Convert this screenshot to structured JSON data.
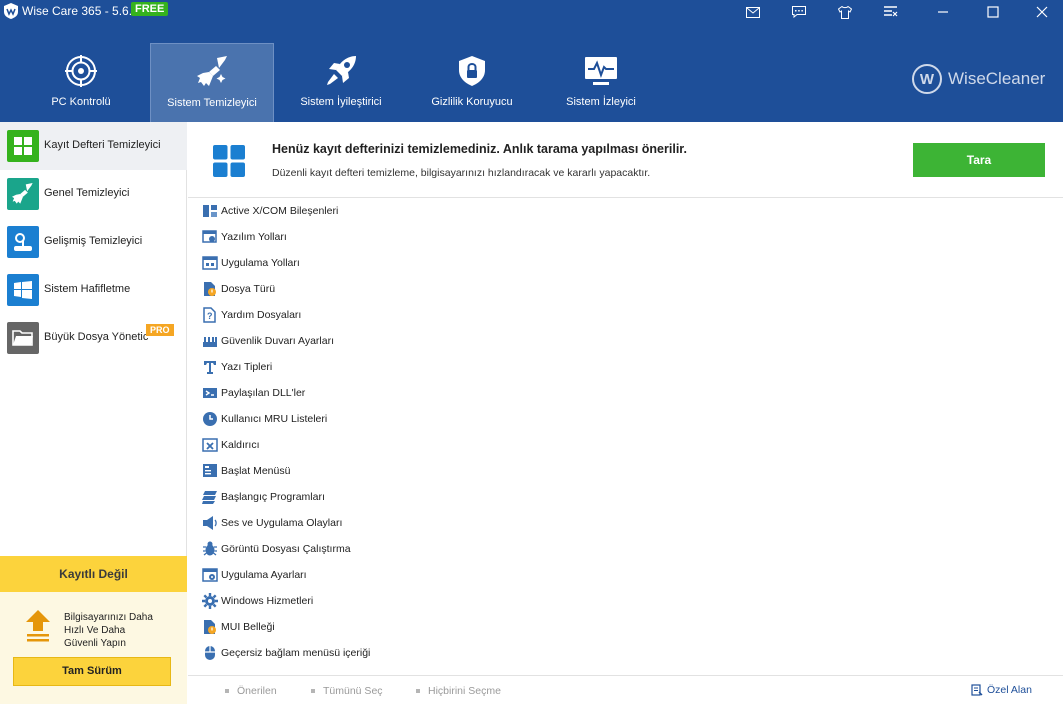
{
  "titlebar": {
    "title": "Wise Care 365 - 5.6.7",
    "badge": "FREE",
    "controls": [
      "mail-icon",
      "feedback-icon",
      "skin-icon",
      "menu-icon",
      "minimize-icon",
      "maximize-icon",
      "close-icon"
    ]
  },
  "nav": {
    "items": [
      {
        "label": "PC Kontrolü",
        "icon": "crosshair-icon"
      },
      {
        "label": "Sistem Temizleyici",
        "icon": "broom-icon",
        "active": true
      },
      {
        "label": "Sistem İyileştirici",
        "icon": "rocket-icon"
      },
      {
        "label": "Gizlilik Koruyucu",
        "icon": "shield-lock-icon"
      },
      {
        "label": "Sistem İzleyici",
        "icon": "monitor-pulse-icon"
      }
    ],
    "brand": "WiseCleaner",
    "brand_letter": "W"
  },
  "sidebar": {
    "items": [
      {
        "label": "Kayıt Defteri Temizleyici",
        "color": "#35b21d",
        "active": true
      },
      {
        "label": "Genel Temizleyici",
        "color": "#1aa58b"
      },
      {
        "label": "Gelişmiş Temizleyici",
        "color": "#1b7fd1"
      },
      {
        "label": "Sistem Hafifletme",
        "color": "#1b7fd1"
      },
      {
        "label": "Büyük Dosya Yönetic",
        "color": "#666666",
        "badge": "PRO"
      }
    ],
    "promo": {
      "title": "Kayıtlı Değil",
      "line1": "Bilgisayarınızı Daha",
      "line2": "Hızlı Ve Daha",
      "line3": "Güvenli Yapın",
      "button": "Tam Sürüm"
    }
  },
  "banner": {
    "title": "Henüz kayıt defterinizi temizlemediniz. Anlık tarama yapılması önerilir.",
    "subtitle": "Düzenli kayıt defteri temizleme, bilgisayarınızı hızlandıracak ve kararlı yapacaktır.",
    "scan_button": "Tara"
  },
  "list": {
    "items": [
      {
        "label": "Active X/COM Bileşenleri",
        "icon": "component-icon"
      },
      {
        "label": "Yazılım Yolları",
        "icon": "software-path-icon"
      },
      {
        "label": "Uygulama Yolları",
        "icon": "app-path-icon"
      },
      {
        "label": "Dosya Türü",
        "icon": "file-type-icon"
      },
      {
        "label": "Yardım Dosyaları",
        "icon": "help-file-icon"
      },
      {
        "label": "Güvenlik Duvarı Ayarları",
        "icon": "firewall-icon"
      },
      {
        "label": "Yazı Tipleri",
        "icon": "font-icon"
      },
      {
        "label": "Paylaşılan DLL'ler",
        "icon": "dll-icon"
      },
      {
        "label": "Kullanıcı MRU Listeleri",
        "icon": "clock-icon"
      },
      {
        "label": "Kaldırıcı",
        "icon": "uninstall-icon"
      },
      {
        "label": "Başlat Menüsü",
        "icon": "start-menu-icon"
      },
      {
        "label": "Başlangıç Programları",
        "icon": "startup-icon"
      },
      {
        "label": "Ses ve Uygulama Olayları",
        "icon": "speaker-icon"
      },
      {
        "label": "Görüntü Dosyası Çalıştırma",
        "icon": "bug-icon"
      },
      {
        "label": "Uygulama Ayarları",
        "icon": "app-settings-icon"
      },
      {
        "label": "Windows Hizmetleri",
        "icon": "gear-icon"
      },
      {
        "label": "MUI Belleği",
        "icon": "mui-icon"
      },
      {
        "label": "Geçersiz bağlam menüsü içeriği",
        "icon": "mouse-icon"
      }
    ]
  },
  "footer": {
    "recommended": "Önerilen",
    "select_all": "Tümünü Seç",
    "select_none": "Hiçbirini Seçme",
    "custom_area": "Özel Alan"
  },
  "colors": {
    "header": "#1e4f99",
    "accent_green": "#3db435",
    "promo_yellow": "#fcd33c",
    "icon_blue": "#3a6fb0"
  }
}
